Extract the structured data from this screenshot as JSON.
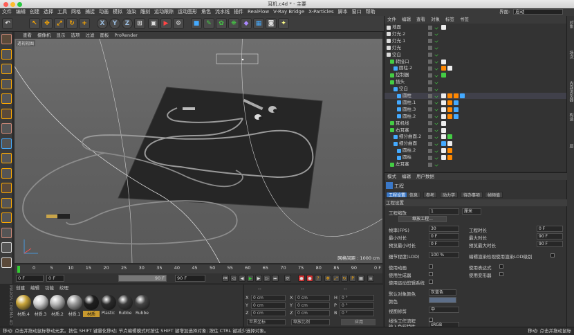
{
  "window": {
    "title": "耳机.c4d * - 主要"
  },
  "menu": [
    "文件",
    "编辑",
    "创建",
    "选择",
    "工具",
    "网格",
    "捕捉",
    "动画",
    "模拟",
    "渲染",
    "雕刻",
    "运动跟踪",
    "运动图形",
    "角色",
    "流水线",
    "插件",
    "RealFlow",
    "V-Ray Bridge",
    "X-Particles",
    "脚本",
    "窗口",
    "帮助"
  ],
  "layout": {
    "label": "界面:",
    "value": "启动"
  },
  "viewport": {
    "menu": [
      "查看",
      "摄像机",
      "显示",
      "选项",
      "过滤",
      "面板",
      "ProRender"
    ],
    "label": "透视视图",
    "grid": "网格间距 : 1000 cm"
  },
  "timeline": {
    "ticks": [
      "0",
      "5",
      "10",
      "15",
      "20",
      "25",
      "30",
      "35",
      "40",
      "45",
      "50",
      "55",
      "60",
      "65",
      "70",
      "75",
      "80",
      "85",
      "90"
    ],
    "end": "0 F"
  },
  "transport": {
    "start": "0 F",
    "cur": "0 F",
    "end": "90 F",
    "end2": "90 F"
  },
  "materials": {
    "menu": [
      "创建",
      "编辑",
      "功能",
      "纹理"
    ],
    "items": [
      {
        "name": "材质.4",
        "color": "#c8a43a"
      },
      {
        "name": "材质.3",
        "color": "#d0d0d0"
      },
      {
        "name": "材质.2",
        "color": "#b8b8b8"
      },
      {
        "name": "材质.1",
        "color": "#9a9a9a"
      },
      {
        "name": "材质",
        "color": "#1e1e1e"
      },
      {
        "name": "Plastic",
        "color": "#2a2a2a"
      },
      {
        "name": "Rubbe",
        "color": "#3a3a3a"
      },
      {
        "name": "Rubbe",
        "color": "#444"
      }
    ]
  },
  "coords": {
    "headers": [
      "--",
      "--",
      "--"
    ],
    "rows": [
      {
        "a": "X",
        "v1": "0 cm",
        "b": "X",
        "v2": "0 cm",
        "c": "H",
        "v3": "0 °"
      },
      {
        "a": "Y",
        "v1": "0 cm",
        "b": "Y",
        "v2": "0 cm",
        "c": "P",
        "v3": "0 °"
      },
      {
        "a": "Z",
        "v1": "0 cm",
        "b": "Z",
        "v2": "0 cm",
        "c": "B",
        "v3": "0 °"
      }
    ],
    "mode": "世界坐标",
    "scale": "缩放比例",
    "apply": "应用"
  },
  "objects": {
    "menu": [
      "文件",
      "编辑",
      "查看",
      "对象",
      "标签",
      "书签"
    ],
    "items": [
      {
        "name": "地面",
        "indent": 0
      },
      {
        "name": "灯光.2",
        "indent": 0
      },
      {
        "name": "灯光.1",
        "indent": 0
      },
      {
        "name": "灯光",
        "indent": 0
      },
      {
        "name": "空白",
        "indent": 0
      },
      {
        "name": "转接口",
        "indent": 1
      },
      {
        "name": "圆柱.2",
        "indent": 2
      },
      {
        "name": "控制器",
        "indent": 1
      },
      {
        "name": "插头",
        "indent": 1
      },
      {
        "name": "空白",
        "indent": 2
      },
      {
        "name": "圆柱",
        "indent": 3
      },
      {
        "name": "圆柱.1",
        "indent": 3
      },
      {
        "name": "圆柱.3",
        "indent": 3
      },
      {
        "name": "圆柱.2",
        "indent": 3
      },
      {
        "name": "耳机线",
        "indent": 1
      },
      {
        "name": "右耳塞",
        "indent": 1
      },
      {
        "name": "细分曲面.2",
        "indent": 2
      },
      {
        "name": "细分曲面",
        "indent": 2
      },
      {
        "name": "圆柱.2",
        "indent": 3
      },
      {
        "name": "圆柱",
        "indent": 3
      },
      {
        "name": "左耳塞",
        "indent": 1
      }
    ]
  },
  "side_tabs": [
    "对象",
    "场次",
    "内容浏览器",
    "构造",
    "层"
  ],
  "attributes": {
    "menu": [
      "模式",
      "编辑",
      "用户数据"
    ],
    "title": "工程",
    "tabs": [
      "工程设置",
      "信息",
      "参考",
      "动力学",
      "待办事项",
      "帧频值"
    ],
    "section": "工程设置",
    "scale_label": "工程缩放",
    "scale_value": "1",
    "scale_unit": "厘米",
    "scale_btn": "缩放工程...",
    "fps_label": "帧率(FPS)",
    "fps": "30",
    "dur_label": "工程时长",
    "dur": "0 F",
    "min_label": "最小时长",
    "min": "0 F",
    "max_label": "最大时长",
    "max": "90 F",
    "pmin_label": "预览最小时长",
    "pmin": "0 F",
    "pmax_label": "预览最大时长",
    "pmax": "90 F",
    "lod_label": "细节程度(LOD)",
    "lod": "100 %",
    "lod_check": "编辑渲染检视使用渲染LOD级别",
    "anim": "使用动画",
    "expr": "使用表达式",
    "gen": "使用生成器",
    "deform": "使用变形器",
    "motion": "使用运动剪辑系统",
    "defcolor_label": "默认对象颜色",
    "defcolor": "灰蓝色",
    "color_label": "颜色",
    "view_label": "视图修剪",
    "view": "中",
    "linear": "线性工作流程",
    "input_label": "输入色彩特性",
    "input": "sRGB"
  },
  "status": {
    "left": "移动: 点击并拖动鼠标移动元素。按住 SHIFT 键量化移动; 节点编辑模式时按住 SHIFT 键增加选择对象; 按住 CTRL 键减少选择对象。",
    "right": "移动: 点击并拖动鼠标"
  }
}
